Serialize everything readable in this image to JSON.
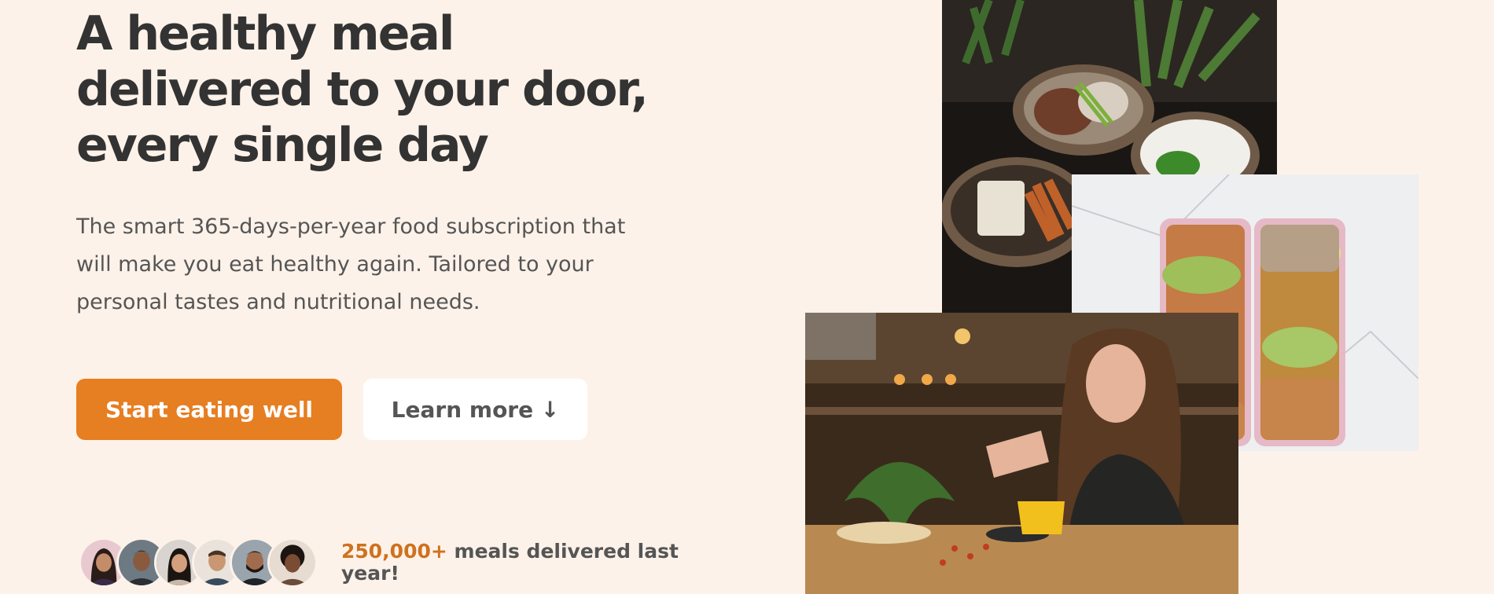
{
  "hero": {
    "title_line1": "A healthy meal",
    "title_line2": "delivered to your door,",
    "title_line3": "every single day",
    "description_line1": "The smart 365-days-per-year food subscription that",
    "description_line2": "will make you eat healthy again. Tailored to your",
    "description_line3": "personal tastes and nutritional needs.",
    "primary_cta": "Start eating well",
    "secondary_cta": "Learn more ↓"
  },
  "delivered": {
    "count": "250,000+",
    "text_line1_rest": " meals delivered last",
    "text_line2": "year!",
    "avatars": [
      "customer-1",
      "customer-2",
      "customer-3",
      "customer-4",
      "customer-5",
      "customer-6"
    ]
  },
  "colors": {
    "background": "#fdf2e9",
    "accent": "#e67e22",
    "accent_dark": "#cf711f",
    "heading": "#333333",
    "text": "#555555"
  }
}
